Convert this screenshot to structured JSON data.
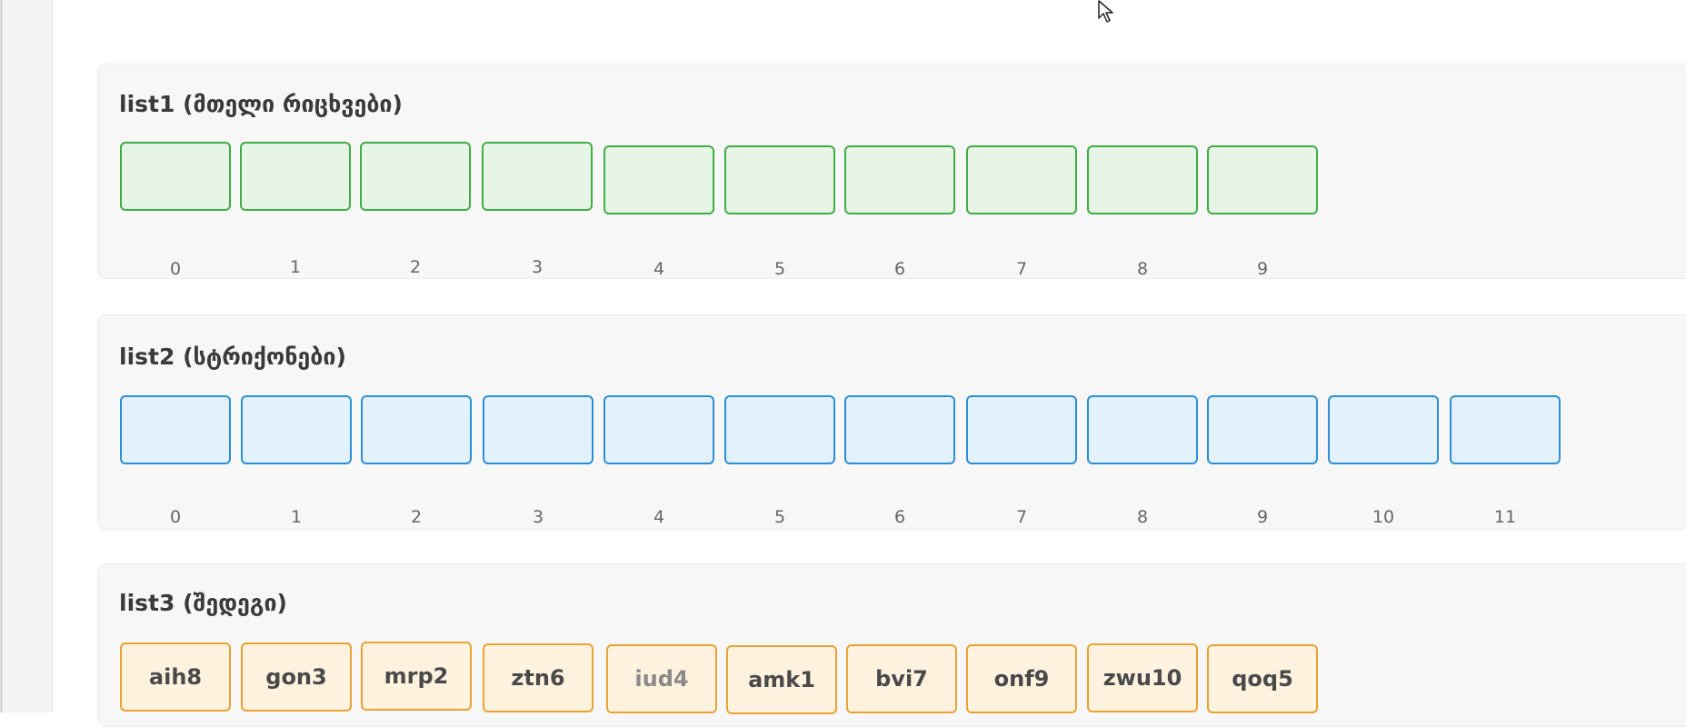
{
  "list1": {
    "title": "list1 (მთელი რიცხვები)",
    "indices": [
      "0",
      "1",
      "2",
      "3",
      "4",
      "5",
      "6",
      "7",
      "8",
      "9"
    ]
  },
  "list2": {
    "title": "list2 (სტრიქონები)",
    "indices": [
      "0",
      "1",
      "2",
      "3",
      "4",
      "5",
      "6",
      "7",
      "8",
      "9",
      "10",
      "11"
    ]
  },
  "list3": {
    "title": "list3 (შედეგი)",
    "values": [
      "aih8",
      "gon3",
      "mrp2",
      "ztn6",
      "iud4",
      "amk1",
      "bvi7",
      "onf9",
      "zwu10",
      "qoq5"
    ]
  },
  "colors": {
    "list1_fill": "#e7f5e7",
    "list1_border": "#3eae44",
    "list2_fill": "#e3f1fc",
    "list2_border": "#2b8fd8",
    "list3_fill": "#fff2de",
    "list3_border": "#eaa233"
  },
  "icons": {
    "cursor": "mouse-pointer-icon"
  }
}
